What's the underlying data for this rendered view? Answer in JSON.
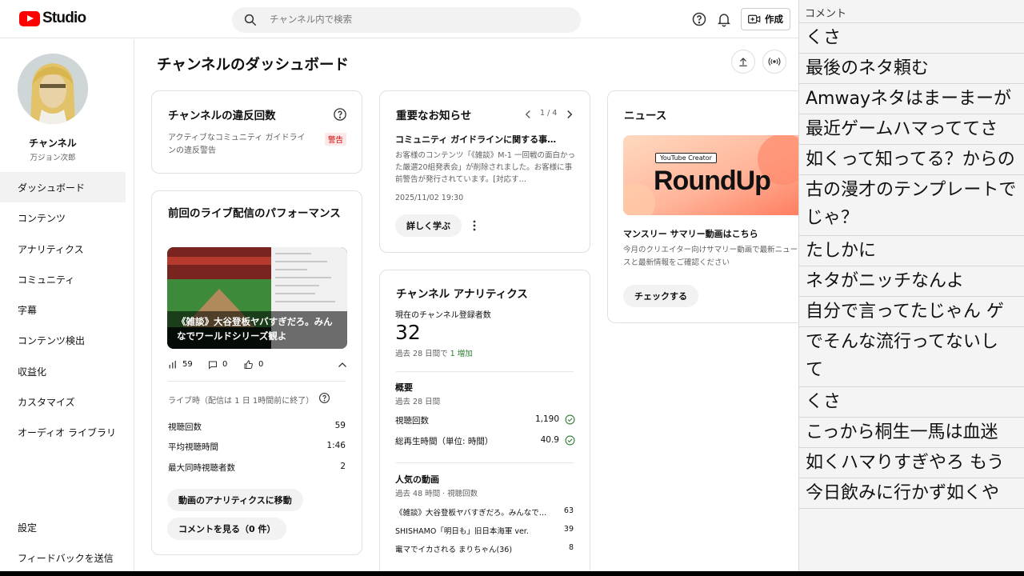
{
  "topbar": {
    "logo_text": "Studio",
    "search_placeholder": "チャンネル内で検索",
    "create_label": "作成"
  },
  "sidebar": {
    "channel_name": "チャンネル",
    "channel_sub": "万ジョン次郎",
    "items": [
      {
        "label": "ダッシュボード",
        "active": true
      },
      {
        "label": "コンテンツ"
      },
      {
        "label": "アナリティクス"
      },
      {
        "label": "コミュニティ"
      },
      {
        "label": "字幕"
      },
      {
        "label": "コンテンツ検出"
      },
      {
        "label": "収益化"
      },
      {
        "label": "カスタマイズ"
      },
      {
        "label": "オーディオ ライブラリ"
      }
    ],
    "bottom_items": [
      {
        "label": "設定"
      },
      {
        "label": "フィードバックを送信"
      }
    ]
  },
  "main": {
    "title": "チャンネルのダッシュボード",
    "violations": {
      "title": "チャンネルの違反回数",
      "text": "アクティブなコミュニティ ガイドラインの違反警告",
      "badge": "警告"
    },
    "live": {
      "title": "前回のライブ配信のパフォーマンス",
      "thumb_caption": "《雑談》大谷登板ヤバすぎだろ。みんなでワールドシリーズ観よ",
      "views": "59",
      "comments": "0",
      "likes": "0",
      "period_label": "ライブ時（配信は 1 日 1時間前に終了）",
      "stats": [
        {
          "label": "視聴回数",
          "value": "59"
        },
        {
          "label": "平均視聴時間",
          "value": "1:46"
        },
        {
          "label": "最大同時視聴者数",
          "value": "2"
        }
      ],
      "btn_analytics": "動画のアナリティクスに移動",
      "btn_comments": "コメントを見る（0 件）"
    },
    "notice": {
      "title": "重要なお知らせ",
      "pager": "1 / 4",
      "headline": "コミュニティ ガイドラインに関する事…",
      "body": "お客様のコンテンツ「《雑談》M-1 一回戦の面白かった厳選20組発表会」が削除されました。お客様に事前警告が発行されています。[対応す…",
      "date": "2025/11/02 19:30",
      "learn_more": "詳しく学ぶ"
    },
    "analytics": {
      "title": "チャンネル アナリティクス",
      "subs_label": "現在のチャンネル登録者数",
      "subs_value": "32",
      "subs_change_prefix": "過去 28 日間で",
      "subs_change": "1 増加",
      "summary_title": "概要",
      "summary_period": "過去 28 日間",
      "summary": [
        {
          "label": "視聴回数",
          "value": "1,190"
        },
        {
          "label": "総再生時間（単位: 時間）",
          "value": "40.9"
        }
      ],
      "top_title": "人気の動画",
      "top_period": "過去 48 時間 · 視聴回数",
      "top_videos": [
        {
          "title": "《雑談》大谷登板ヤバすぎだろ。みんなで…",
          "value": "63"
        },
        {
          "title": "SHISHAMO「明日も」旧日本海軍 ver.",
          "value": "39"
        },
        {
          "title": "竃マでイカされる まりちゃん(36)",
          "value": "8"
        }
      ]
    },
    "news": {
      "title": "ニュース",
      "banner_tag": "YouTube Creator",
      "banner_word": "RoundUp",
      "headline": "マンスリー サマリー動画はこちら",
      "body": "今月のクリエイター向けサマリー動画で最新ニュースと最新情報をご確認ください",
      "btn": "チェックする"
    }
  },
  "comments": {
    "header": "コメント",
    "lines": [
      "くさ",
      "最後のネタ頼む",
      "Amwayネタはまーまーが",
      "最近ゲームハマっててさ",
      "如くって知ってる？からの",
      "古の漫才のテンプレートで",
      "じゃ？",
      "たしかに",
      "ネタがニッチなんよ",
      "自分で言ってたじゃん ゲ",
      "でそんな流行ってないし",
      "て",
      "くさ",
      "こっから桐生一馬は血迷",
      "如くハマりすぎやろ もう",
      "今日飲みに行かず如くや"
    ]
  },
  "colors": {
    "brand_red": "#ff0000",
    "badge_red": "#cc0000",
    "badge_bg": "#fde8e8",
    "increase_green": "#2e7d32"
  }
}
